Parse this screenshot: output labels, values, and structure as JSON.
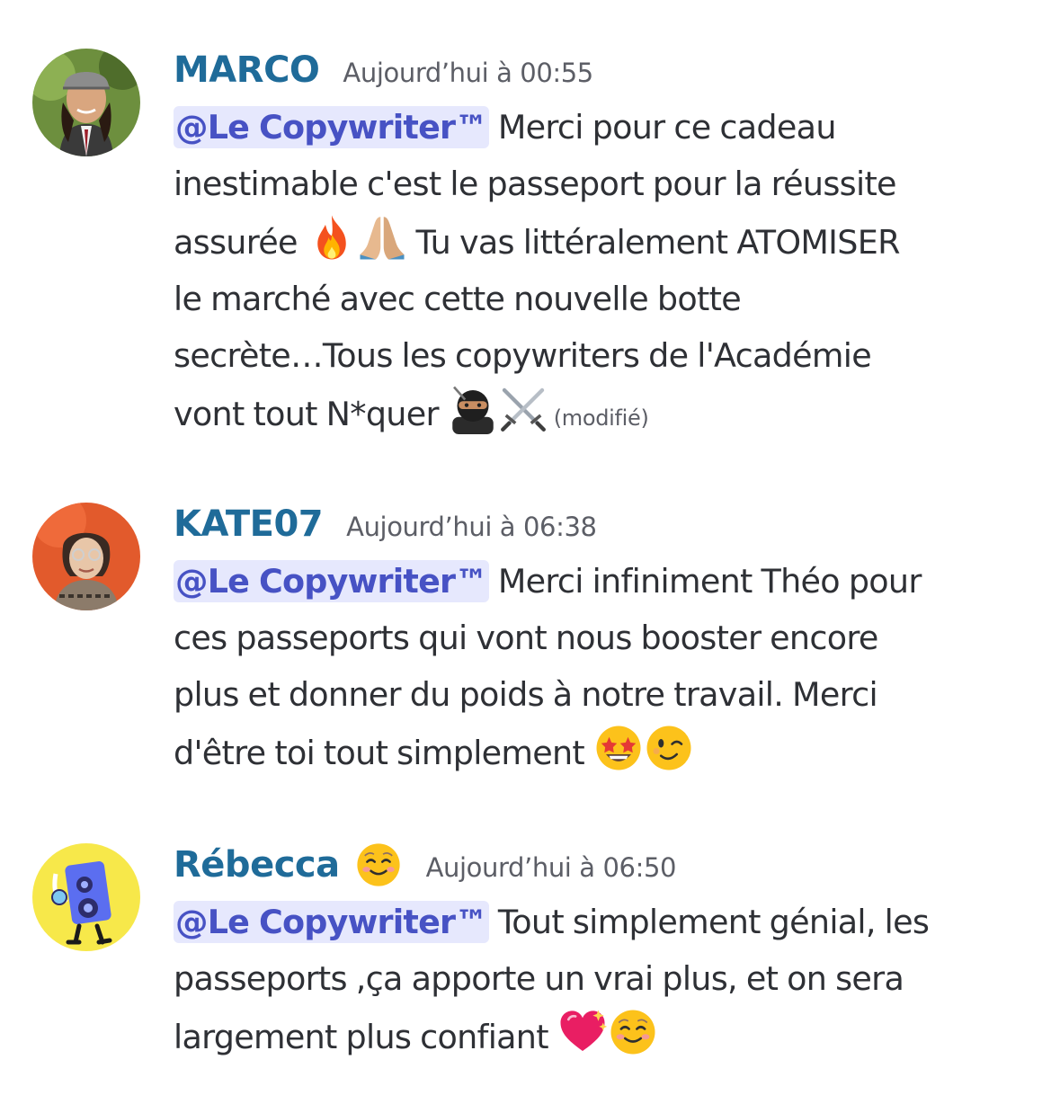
{
  "messages": [
    {
      "username": "MARCO",
      "timestamp": "Aujourd’hui à 00:55",
      "mention": "@Le Copywriter™",
      "lines": [
        " Merci pour ce cadeau",
        "inestimable c'est le passeport pour la réussite",
        "assurée ",
        " Tu vas littéralement ATOMISER",
        "le marché avec cette nouvelle botte",
        "secrète…Tous les copywriters de l'Académie",
        "vont tout N*quer "
      ],
      "edited_label": "(modifié)",
      "emojis": [
        "fire-emoji",
        "praying-hands-emoji",
        "ninja-emoji",
        "crossed-swords-emoji"
      ]
    },
    {
      "username": "KATE07",
      "timestamp": "Aujourd’hui à 06:38",
      "mention": "@Le Copywriter™",
      "lines": [
        " Merci infiniment Théo pour",
        "ces passeports qui vont nous booster encore",
        "plus et donner du poids à notre travail. Merci",
        "d'être toi tout simplement "
      ],
      "emojis": [
        "star-struck-emoji",
        "winking-face-emoji"
      ]
    },
    {
      "username": "Rébecca",
      "status_emoji": "smiling-face-emoji",
      "timestamp": "Aujourd’hui à 06:50",
      "mention": "@Le Copywriter™",
      "lines": [
        " Tout simplement génial, les",
        "passeports ,ça apporte un vrai plus, et on sera",
        "largement plus confiant "
      ],
      "emojis": [
        "sparkling-heart-emoji",
        "smiling-face-emoji"
      ]
    }
  ],
  "colors": {
    "username": "#1f6b99",
    "mention_bg": "#e6e8fd",
    "mention_text": "#4752c4",
    "text": "#2e3035",
    "muted": "#5c5e66"
  }
}
